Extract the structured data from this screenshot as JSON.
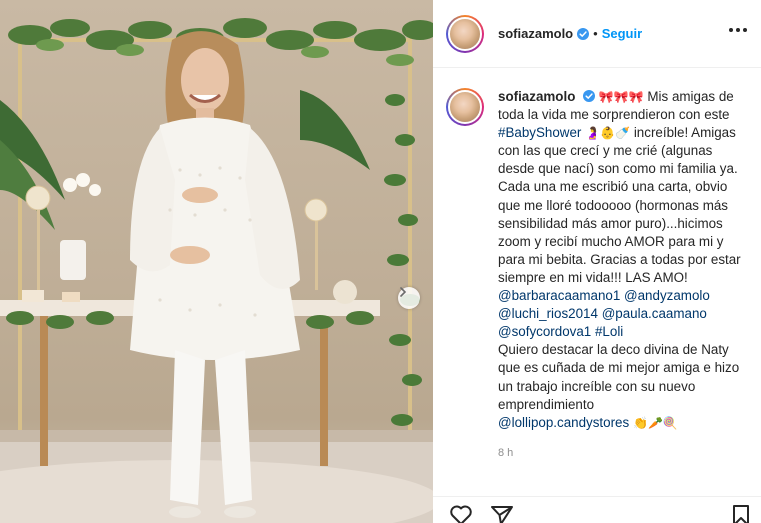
{
  "post": {
    "username": "sofiazamolo",
    "follow_label": "Seguir",
    "separator": "•",
    "caption": {
      "username": "sofiazamolo",
      "emoji_bows": "🎀🎀🎀",
      "text_1": " Mis amigas de toda la vida me sorprendieron con este ",
      "hashtag_babyshower": "#BabyShower",
      "emoji_baby": " 🤰👶🍼 ",
      "text_2": "increíble! Amigas con las que crecí y me crié (algunas desde que nací) son como mi familia ya. Cada una me escribió una carta, obvio que me lloré todooooo (hormonas más sensibilidad más amor puro)...hicimos zoom y recibí mucho AMOR para mi y para mi bebita. Gracias a todas por estar siempre en mi vida!!! LAS AMO!",
      "mentions": [
        "@barbaracaamano1",
        "@andyzamolo",
        "@luchi_rios2014",
        "@paula.caamano",
        "@sofycordova1"
      ],
      "hashtag_loli": "#Loli",
      "text_3": "Quiero destacar la deco divina de Naty que es cuñada de mi mejor amiga e hizo un trabajo increíble con su nuevo emprendimiento",
      "mention_store": "@lollipop.candystores",
      "emoji_end": " 👏🥕🍭"
    },
    "timestamp": "8 h"
  },
  "icons": {
    "verified": "verified-badge-icon",
    "more": "more-options-icon",
    "like": "heart-icon",
    "share": "send-icon",
    "save": "bookmark-icon",
    "next": "chevron-right-icon"
  },
  "colors": {
    "accent": "#0095f6",
    "link": "#00376b",
    "muted": "#8e8e8e",
    "text": "#262626"
  }
}
